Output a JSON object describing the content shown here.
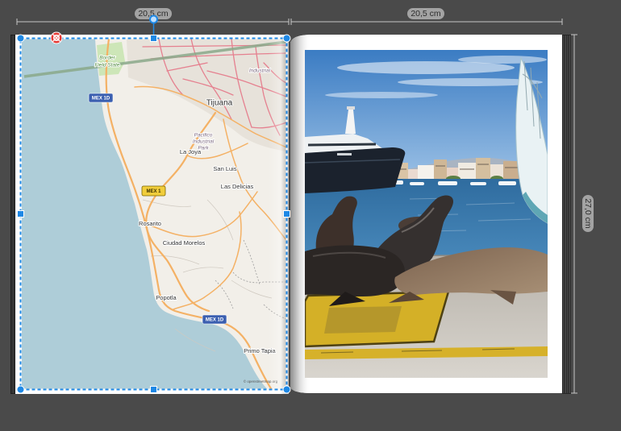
{
  "workspace": {
    "background_color": "#4a4a4a",
    "selection_color": "#1e88e5",
    "remove_color": "#e53935"
  },
  "rulers": {
    "left_page_width": "20,5 cm",
    "right_page_width": "20,5 cm",
    "page_height": "27,0 cm"
  },
  "left_page": {
    "map": {
      "selected": true,
      "places": {
        "border_field_line1": "Border",
        "border_field_line2": "Field State",
        "industrial": "Industrial",
        "tijuana": "Tijuana",
        "pacifico_line1": "Pacifico",
        "pacifico_line2": "Industrial",
        "pacifico_line3": "Park",
        "la_joya": "La Joya",
        "san_luis": "San Luis",
        "las_delicias": "Las Delicias",
        "rosarito": "Rosarito",
        "ciudad_morelos": "Ciudad Morelos",
        "popotla": "Popotla",
        "primo_tapia": "Primo Tapia"
      },
      "shields": {
        "mex_1d_north": "MEX 1D",
        "mex_1": "MEX 1",
        "mex_1d_south": "MEX 1D"
      },
      "attribution": "© openstreetmap.org",
      "colors": {
        "water": "#aecdd8",
        "land": "#f2efe9",
        "major_road": "#f4b165",
        "urban_road": "#e5808f",
        "motorway_shield": "#3b5fb0",
        "highway_shield": "#f1cd3b"
      }
    }
  },
  "right_page": {
    "photo": {
      "selected": false
    }
  },
  "selection_tools": {
    "remove_icon": "remove-icon",
    "rotate_icon": "rotate-handle-icon",
    "resize_icon": "resize-handle-icon"
  }
}
